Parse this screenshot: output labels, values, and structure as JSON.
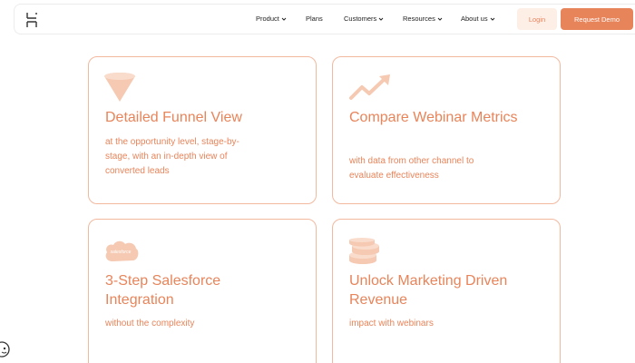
{
  "nav": {
    "items": [
      {
        "label": "Product",
        "dropdown": true
      },
      {
        "label": "Plans",
        "dropdown": false
      },
      {
        "label": "Customers",
        "dropdown": true
      },
      {
        "label": "Resources",
        "dropdown": true
      },
      {
        "label": "About us",
        "dropdown": true
      }
    ],
    "login_label": "Login",
    "demo_label": "Request Demo"
  },
  "cards": [
    {
      "icon": "funnel-icon",
      "title": "Detailed Funnel View",
      "description": "at the opportunity level, stage-by-stage, with an in-depth view of converted leads"
    },
    {
      "icon": "trend-arrow-icon",
      "title": "Compare Webinar Metrics",
      "description": "with data from other channel to evaluate effectiveness"
    },
    {
      "icon": "salesforce-cloud-icon",
      "icon_text": "salesforce",
      "title": "3-Step Salesforce Integration",
      "description": "without the complexity"
    },
    {
      "icon": "coin-stack-icon",
      "title": "Unlock Marketing Driven Revenue",
      "description": "impact with webinars"
    }
  ],
  "colors": {
    "accent": "#e8845a",
    "accent_light": "#f5c9b2",
    "card_border": "#f2b99f",
    "login_bg": "#fdeee6"
  }
}
